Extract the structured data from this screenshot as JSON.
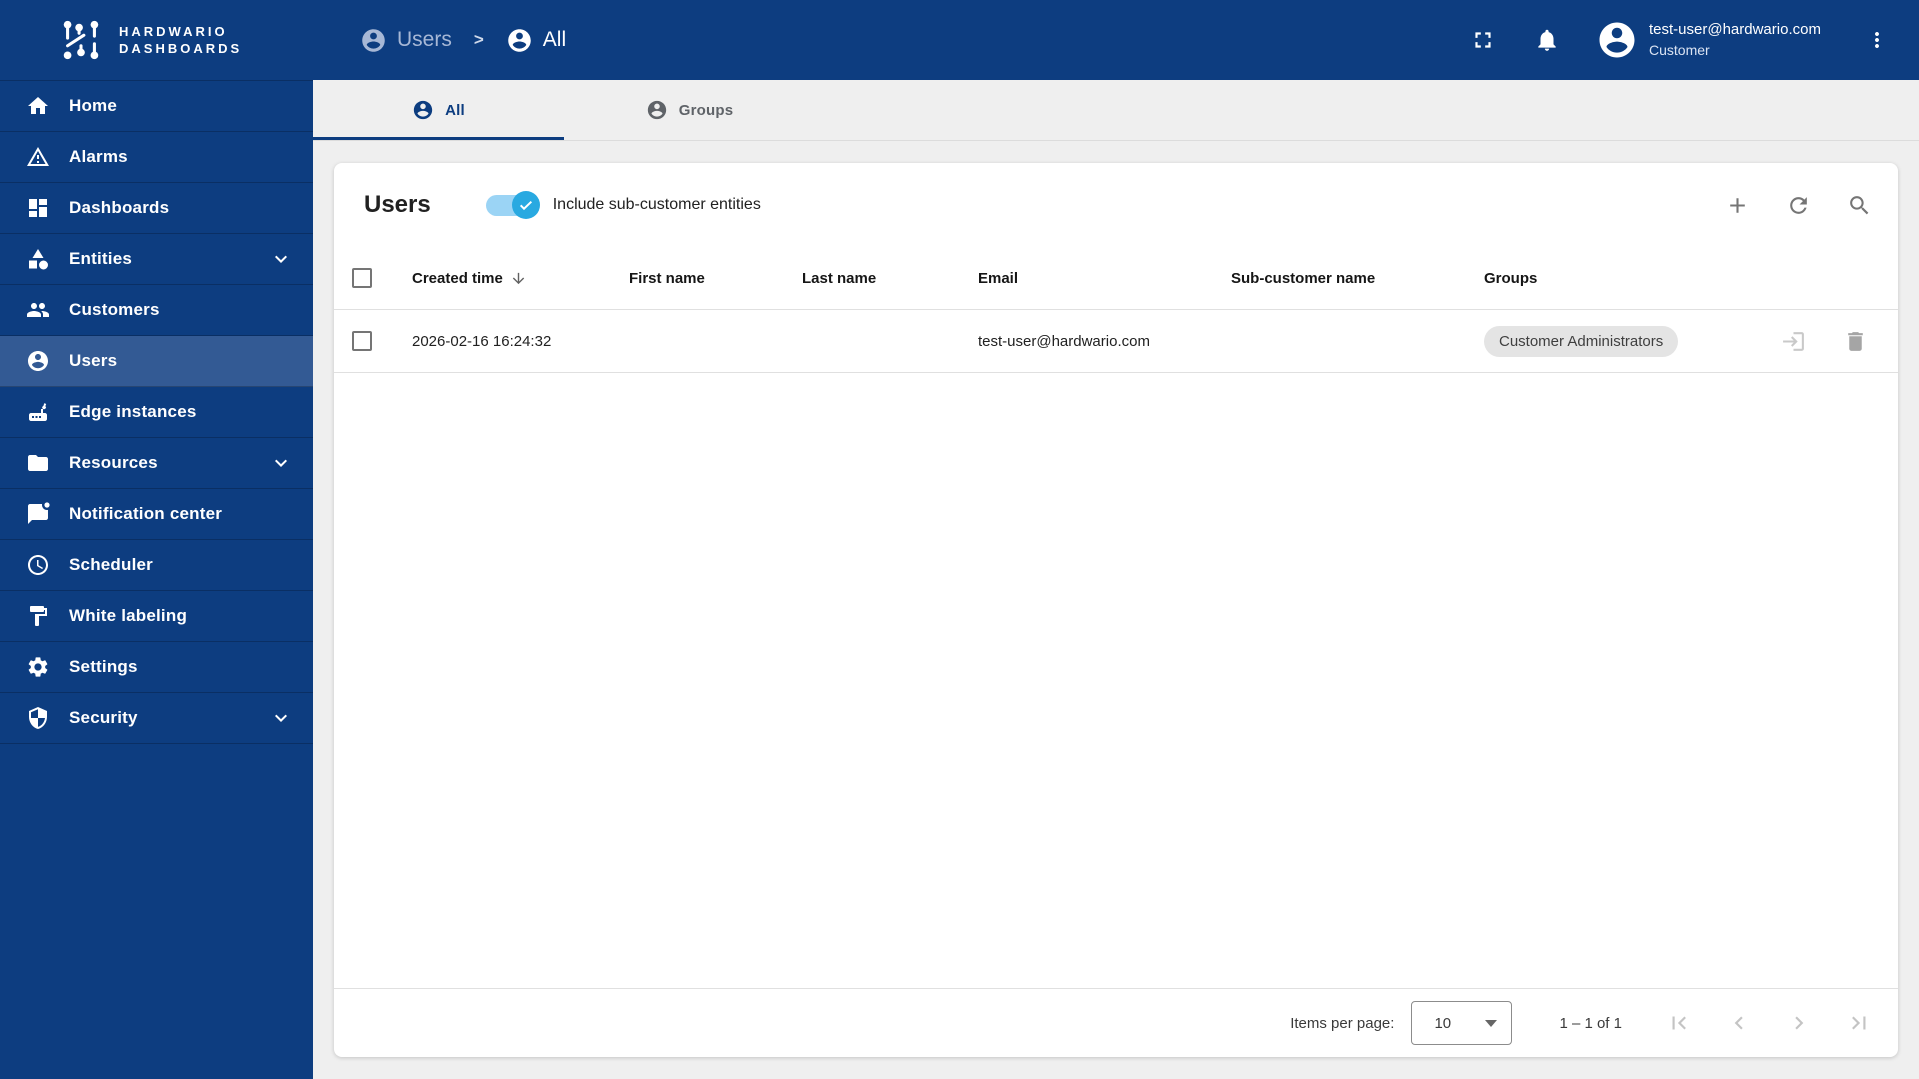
{
  "logo": {
    "line1": "HARDWARIO",
    "line2": "DASHBOARDS"
  },
  "breadcrumb": {
    "parent": "Users",
    "separator": ">",
    "current": "All"
  },
  "topbar": {
    "user_email": "test-user@hardwario.com",
    "user_role": "Customer",
    "icons": [
      "fullscreen-icon",
      "notifications-bell-icon",
      "avatar-icon",
      "more-vertical-icon"
    ]
  },
  "sidebar": {
    "items": [
      {
        "label": "Home",
        "icon": "home-icon",
        "selected": false,
        "expandable": false
      },
      {
        "label": "Alarms",
        "icon": "warning-triangle-icon",
        "selected": false,
        "expandable": false
      },
      {
        "label": "Dashboards",
        "icon": "dashboard-grid-icon",
        "selected": false,
        "expandable": false
      },
      {
        "label": "Entities",
        "icon": "category-shapes-icon",
        "selected": false,
        "expandable": true
      },
      {
        "label": "Customers",
        "icon": "people-icon",
        "selected": false,
        "expandable": false
      },
      {
        "label": "Users",
        "icon": "account-circle-icon",
        "selected": true,
        "expandable": false
      },
      {
        "label": "Edge instances",
        "icon": "router-icon",
        "selected": false,
        "expandable": false
      },
      {
        "label": "Resources",
        "icon": "folder-icon",
        "selected": false,
        "expandable": true
      },
      {
        "label": "Notification center",
        "icon": "chat-unread-icon",
        "selected": false,
        "expandable": false
      },
      {
        "label": "Scheduler",
        "icon": "clock-icon",
        "selected": false,
        "expandable": false
      },
      {
        "label": "White labeling",
        "icon": "format-paint-icon",
        "selected": false,
        "expandable": false
      },
      {
        "label": "Settings",
        "icon": "gear-icon",
        "selected": false,
        "expandable": false
      },
      {
        "label": "Security",
        "icon": "shield-icon",
        "selected": false,
        "expandable": true
      }
    ]
  },
  "tabs": [
    {
      "label": "All",
      "icon": "account-circle-icon",
      "active": true
    },
    {
      "label": "Groups",
      "icon": "account-circle-icon",
      "active": false
    }
  ],
  "card": {
    "title": "Users",
    "toggle_label": "Include sub-customer entities",
    "toggle_on": true,
    "toolbar_icons": [
      "add-plus-icon",
      "refresh-icon",
      "search-icon"
    ]
  },
  "table": {
    "columns": [
      "Created time",
      "First name",
      "Last name",
      "Email",
      "Sub-customer name",
      "Groups"
    ],
    "sorted_column": "Created time",
    "sort_direction": "desc",
    "rows": [
      {
        "created_time": "2026-02-16 16:24:32",
        "first_name": "",
        "last_name": "",
        "email": "test-user@hardwario.com",
        "sub_customer_name": "",
        "groups": [
          "Customer Administrators"
        ],
        "row_actions": [
          "login-as-user-icon",
          "delete-trash-icon"
        ]
      }
    ]
  },
  "pagination": {
    "items_per_page_label": "Items per page:",
    "page_size": "10",
    "range_label": "1 – 1 of 1",
    "nav_icons": [
      "first-page-icon",
      "previous-page-icon",
      "next-page-icon",
      "last-page-icon"
    ]
  },
  "colors": {
    "navy": "#0d3d80",
    "sidebar_selected": "#335a94",
    "toggle_thumb": "#29a9e1",
    "toggle_track": "#9bd4f5",
    "content_bg": "#efefef",
    "chip_bg": "#e4e4e4"
  }
}
